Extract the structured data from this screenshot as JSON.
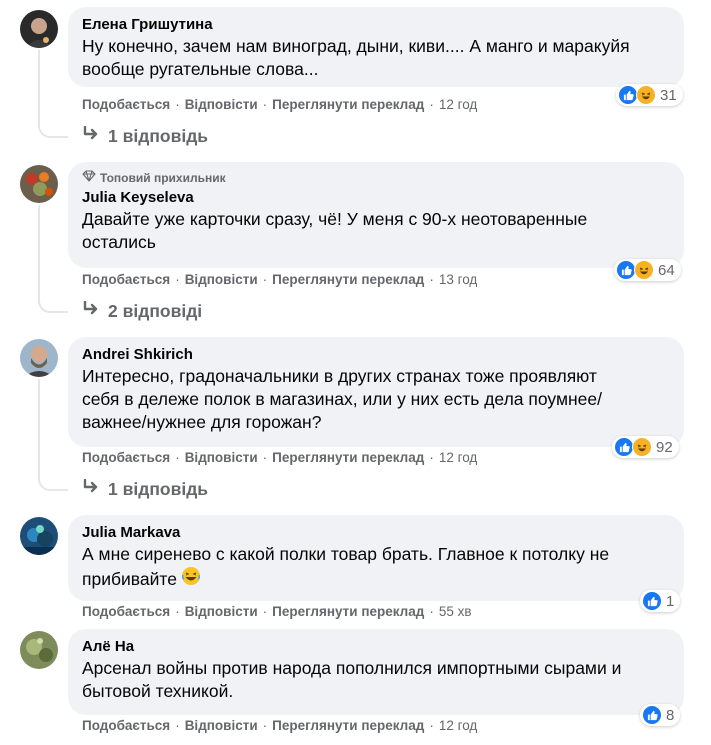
{
  "actions": {
    "like": "Подобається",
    "reply": "Відповісти",
    "translate": "Переглянути переклад",
    "sep": "·"
  },
  "comments": [
    {
      "author": "Елена Гришутина",
      "lines": [
        "Ну конечно, зачем нам виноград, дыни, киви.... А манго и маракуйя",
        "вообще ругательные слова..."
      ],
      "time": "12 год",
      "reaction_count": "31",
      "replies": "1 відповідь"
    },
    {
      "badge": "Топовий прихильник",
      "author": "Julia Keyseleva",
      "lines": [
        "Давайте уже карточки сразу, чё! У меня с 90-х неотоваренные",
        "остались"
      ],
      "time": "13 год",
      "reaction_count": "64",
      "replies": "2 відповіді"
    },
    {
      "author": "Andrei Shkirich",
      "lines": [
        "Интересно, градоначальники в других странах тоже проявляют",
        "себя в дележе полок в магазинах, или у них есть дела поумнее/",
        "важнее/нужнее для горожан?"
      ],
      "time": "12 год",
      "reaction_count": "92",
      "replies": "1 відповідь"
    },
    {
      "author": "Julia Markava",
      "lines": [
        "А мне сиренево с какой полки товар брать. Главное к потолку не",
        "прибивайте"
      ],
      "time": "55 хв",
      "reaction_count": "1"
    },
    {
      "author": "Алё На",
      "lines": [
        "Арсенал войны против народа пополнился импортными сырами и",
        "бытовой техникой."
      ],
      "time": "12 год",
      "reaction_count": "8"
    }
  ],
  "colors": {
    "bubble": "#f0f2f5",
    "muted": "#65676b",
    "like": "#1877f2",
    "haha": "#f7b125"
  }
}
